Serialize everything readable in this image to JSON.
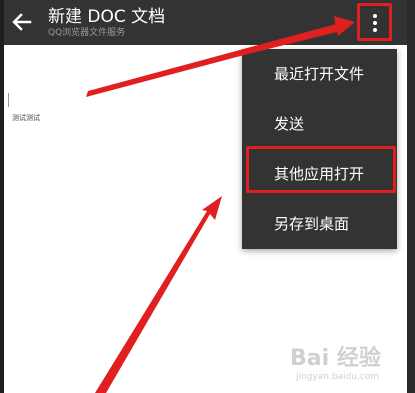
{
  "header": {
    "title": "新建 DOC 文档",
    "subtitle": "QQ浏览器文件服务",
    "back_icon": "arrow-left-icon",
    "overflow_icon": "more-vertical-icon"
  },
  "document": {
    "text": "测试测试"
  },
  "menu": {
    "items": [
      {
        "label": "最近打开文件"
      },
      {
        "label": "发送"
      },
      {
        "label": "其他应用打开"
      },
      {
        "label": "另存到桌面"
      }
    ]
  },
  "watermark": {
    "text": "Bai 经验",
    "sub": "jingyan.baidu.com"
  },
  "colors": {
    "appbar": "#333333",
    "menu": "#333333",
    "annotation_red": "#e02020",
    "text_white": "#ffffff"
  }
}
